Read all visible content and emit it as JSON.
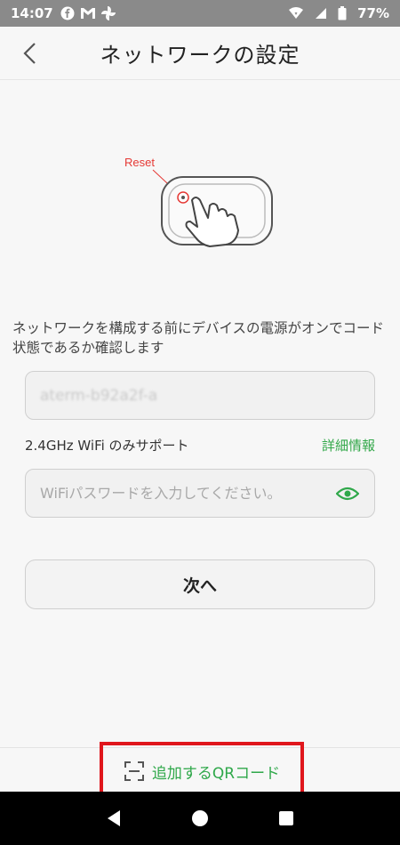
{
  "status_bar": {
    "time": "14:07",
    "battery": "77%",
    "icons": [
      "facebook-icon",
      "gmail-icon",
      "pinwheel-icon",
      "wifi-icon",
      "signal-icon",
      "battery-icon"
    ]
  },
  "header": {
    "title": "ネットワークの設定",
    "back_icon": "chevron-left-icon"
  },
  "illustration": {
    "reset_label": "Reset"
  },
  "instruction": "ネットワークを構成する前にデバイスの電源がオンでコード状態であるか確認します",
  "ssid_field": {
    "value": "aterm-b92a2f-a"
  },
  "support": {
    "text": "2.4GHz WiFi のみサポート",
    "details_link": "詳細情報"
  },
  "password_field": {
    "placeholder": "WiFiパスワードを入力してください。",
    "eye_icon": "eye-icon"
  },
  "next_button": {
    "label": "次へ"
  },
  "qr_button": {
    "label": "追加するQRコード",
    "icon": "scan-frame-icon"
  },
  "colors": {
    "accent": "#2fa84a",
    "highlight_border": "#e0161c",
    "reset_red": "#e53935"
  }
}
